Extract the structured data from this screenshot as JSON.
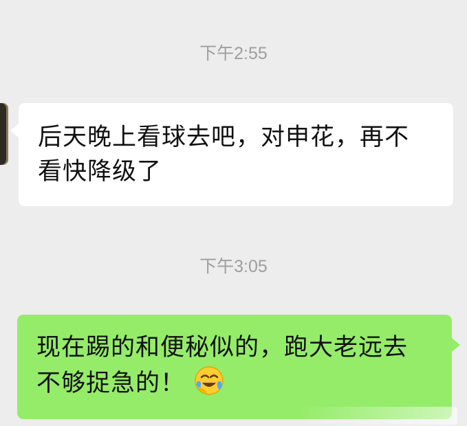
{
  "chat": {
    "timestamps": [
      "下午2:55",
      "下午3:05"
    ],
    "incoming": {
      "line1": "后天晚上看球去吧，对申花，再不",
      "line2": "看快降级了"
    },
    "outgoing": {
      "line1": "现在踢的和便秘似的，跑大老远去",
      "line2": "不够捉急的！",
      "emoji": "crying-laughing-emoji"
    }
  },
  "colors": {
    "background": "#ededed",
    "incoming_bubble": "#ffffff",
    "outgoing_bubble": "#95ec69",
    "timestamp_text": "#9e9e9e"
  }
}
